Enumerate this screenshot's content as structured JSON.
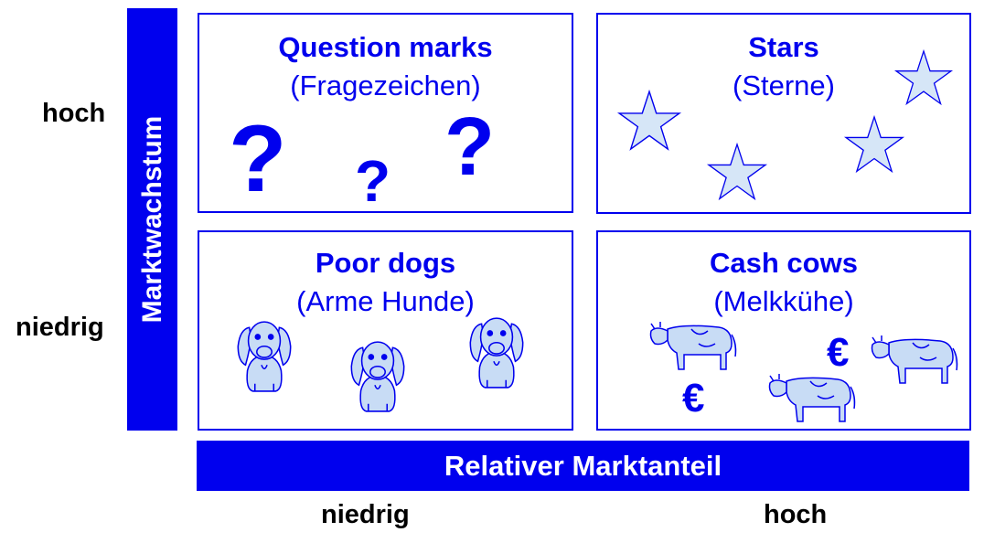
{
  "y_axis": {
    "title": "Marktwachstum",
    "high": "hoch",
    "low": "niedrig"
  },
  "x_axis": {
    "title": "Relativer Marktanteil",
    "low": "niedrig",
    "high": "hoch"
  },
  "quadrants": {
    "question_marks": {
      "title": "Question marks",
      "subtitle": "(Fragezeichen)",
      "symbol": "?"
    },
    "stars": {
      "title": "Stars",
      "subtitle": "(Sterne)"
    },
    "poor_dogs": {
      "title": "Poor dogs",
      "subtitle": "(Arme Hunde)"
    },
    "cash_cows": {
      "title": "Cash cows",
      "subtitle": "(Melkkühe)",
      "symbol": "€"
    }
  },
  "colors": {
    "primary": "#0000ee",
    "star_fill": "#d6e6f7",
    "animal_fill": "#c8dcf5"
  }
}
